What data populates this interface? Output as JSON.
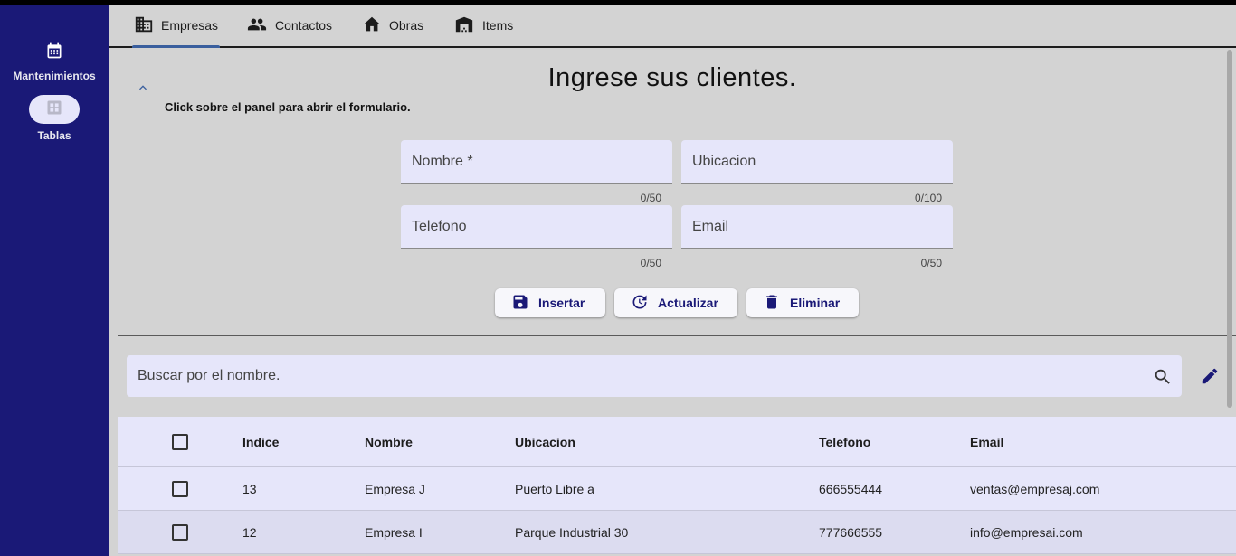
{
  "nav_rail": {
    "items": [
      {
        "label": "Mantenimientos",
        "icon": "calendar-icon"
      },
      {
        "label": "Tablas",
        "icon": "grid-icon",
        "selected": true
      }
    ]
  },
  "tabs": [
    {
      "label": "Empresas",
      "icon": "building-icon",
      "active": true
    },
    {
      "label": "Contactos",
      "icon": "people-icon"
    },
    {
      "label": "Obras",
      "icon": "home-icon"
    },
    {
      "label": "Items",
      "icon": "warehouse-icon"
    }
  ],
  "form": {
    "title": "Ingrese sus clientes.",
    "hint": "Click sobre el panel para abrir el formulario.",
    "fields": {
      "nombre": {
        "placeholder": "Nombre *",
        "value": "",
        "counter": "0/50"
      },
      "ubicacion": {
        "placeholder": "Ubicacion",
        "value": "",
        "counter": "0/100"
      },
      "telefono": {
        "placeholder": "Telefono",
        "value": "",
        "counter": "0/50"
      },
      "email": {
        "placeholder": "Email",
        "value": "",
        "counter": "0/50"
      }
    },
    "buttons": {
      "insert": "Insertar",
      "update": "Actualizar",
      "delete": "Eliminar"
    }
  },
  "search": {
    "placeholder": "Buscar por el nombre.",
    "value": ""
  },
  "table": {
    "columns": [
      "Indice",
      "Nombre",
      "Ubicacion",
      "Telefono",
      "Email"
    ],
    "rows": [
      {
        "indice": "13",
        "nombre": "Empresa J",
        "ubicacion": "Puerto Libre a",
        "telefono": "666555444",
        "email": "ventas@empresaj.com",
        "checked": false
      },
      {
        "indice": "12",
        "nombre": "Empresa I",
        "ubicacion": "Parque Industrial 30",
        "telefono": "777666555",
        "email": "info@empresai.com",
        "checked": false
      }
    ]
  },
  "colors": {
    "rail": "#1a1977",
    "accent": "#1a1977",
    "field_bg": "#e6e6fa",
    "background": "#d3d3d3",
    "active_tab_indicator": "#3a5f9e"
  }
}
